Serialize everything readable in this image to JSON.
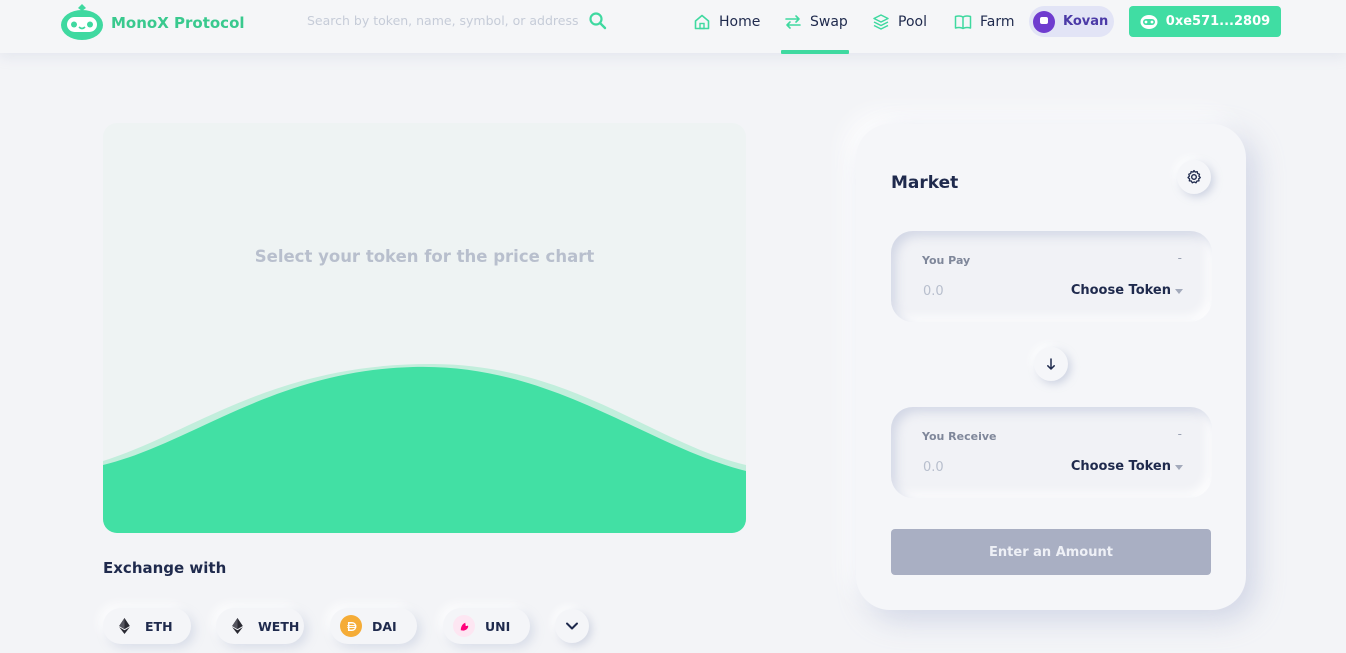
{
  "header": {
    "brand": "MonoX Protocol",
    "search_placeholder": "Search by token, name, symbol, or address",
    "nav": [
      {
        "label": "Home",
        "icon": "home-icon"
      },
      {
        "label": "Swap",
        "icon": "swap-arrows-icon",
        "active": true
      },
      {
        "label": "Pool",
        "icon": "layers-icon"
      },
      {
        "label": "Farm",
        "icon": "book-icon"
      }
    ],
    "network": "Kovan",
    "wallet": "0xe571...2809"
  },
  "chart": {
    "empty_message": "Select your token for the price chart"
  },
  "exchange": {
    "title": "Exchange with",
    "tokens": [
      {
        "symbol": "ETH",
        "icon": "eth-icon"
      },
      {
        "symbol": "WETH",
        "icon": "eth-icon"
      },
      {
        "symbol": "DAI",
        "icon": "dai-icon"
      },
      {
        "symbol": "UNI",
        "icon": "uni-icon"
      }
    ]
  },
  "swap": {
    "title": "Market",
    "pay": {
      "label": "You Pay",
      "balance": "-",
      "amount": "0.0",
      "token": "Choose Token"
    },
    "receive": {
      "label": "You Receive",
      "balance": "-",
      "amount": "0.0",
      "token": "Choose Token"
    },
    "submit": "Enter an Amount"
  },
  "colors": {
    "brand_green": "#40dda3",
    "network_purple": "#6f3ccf",
    "disabled_button": "#a9afc3"
  }
}
